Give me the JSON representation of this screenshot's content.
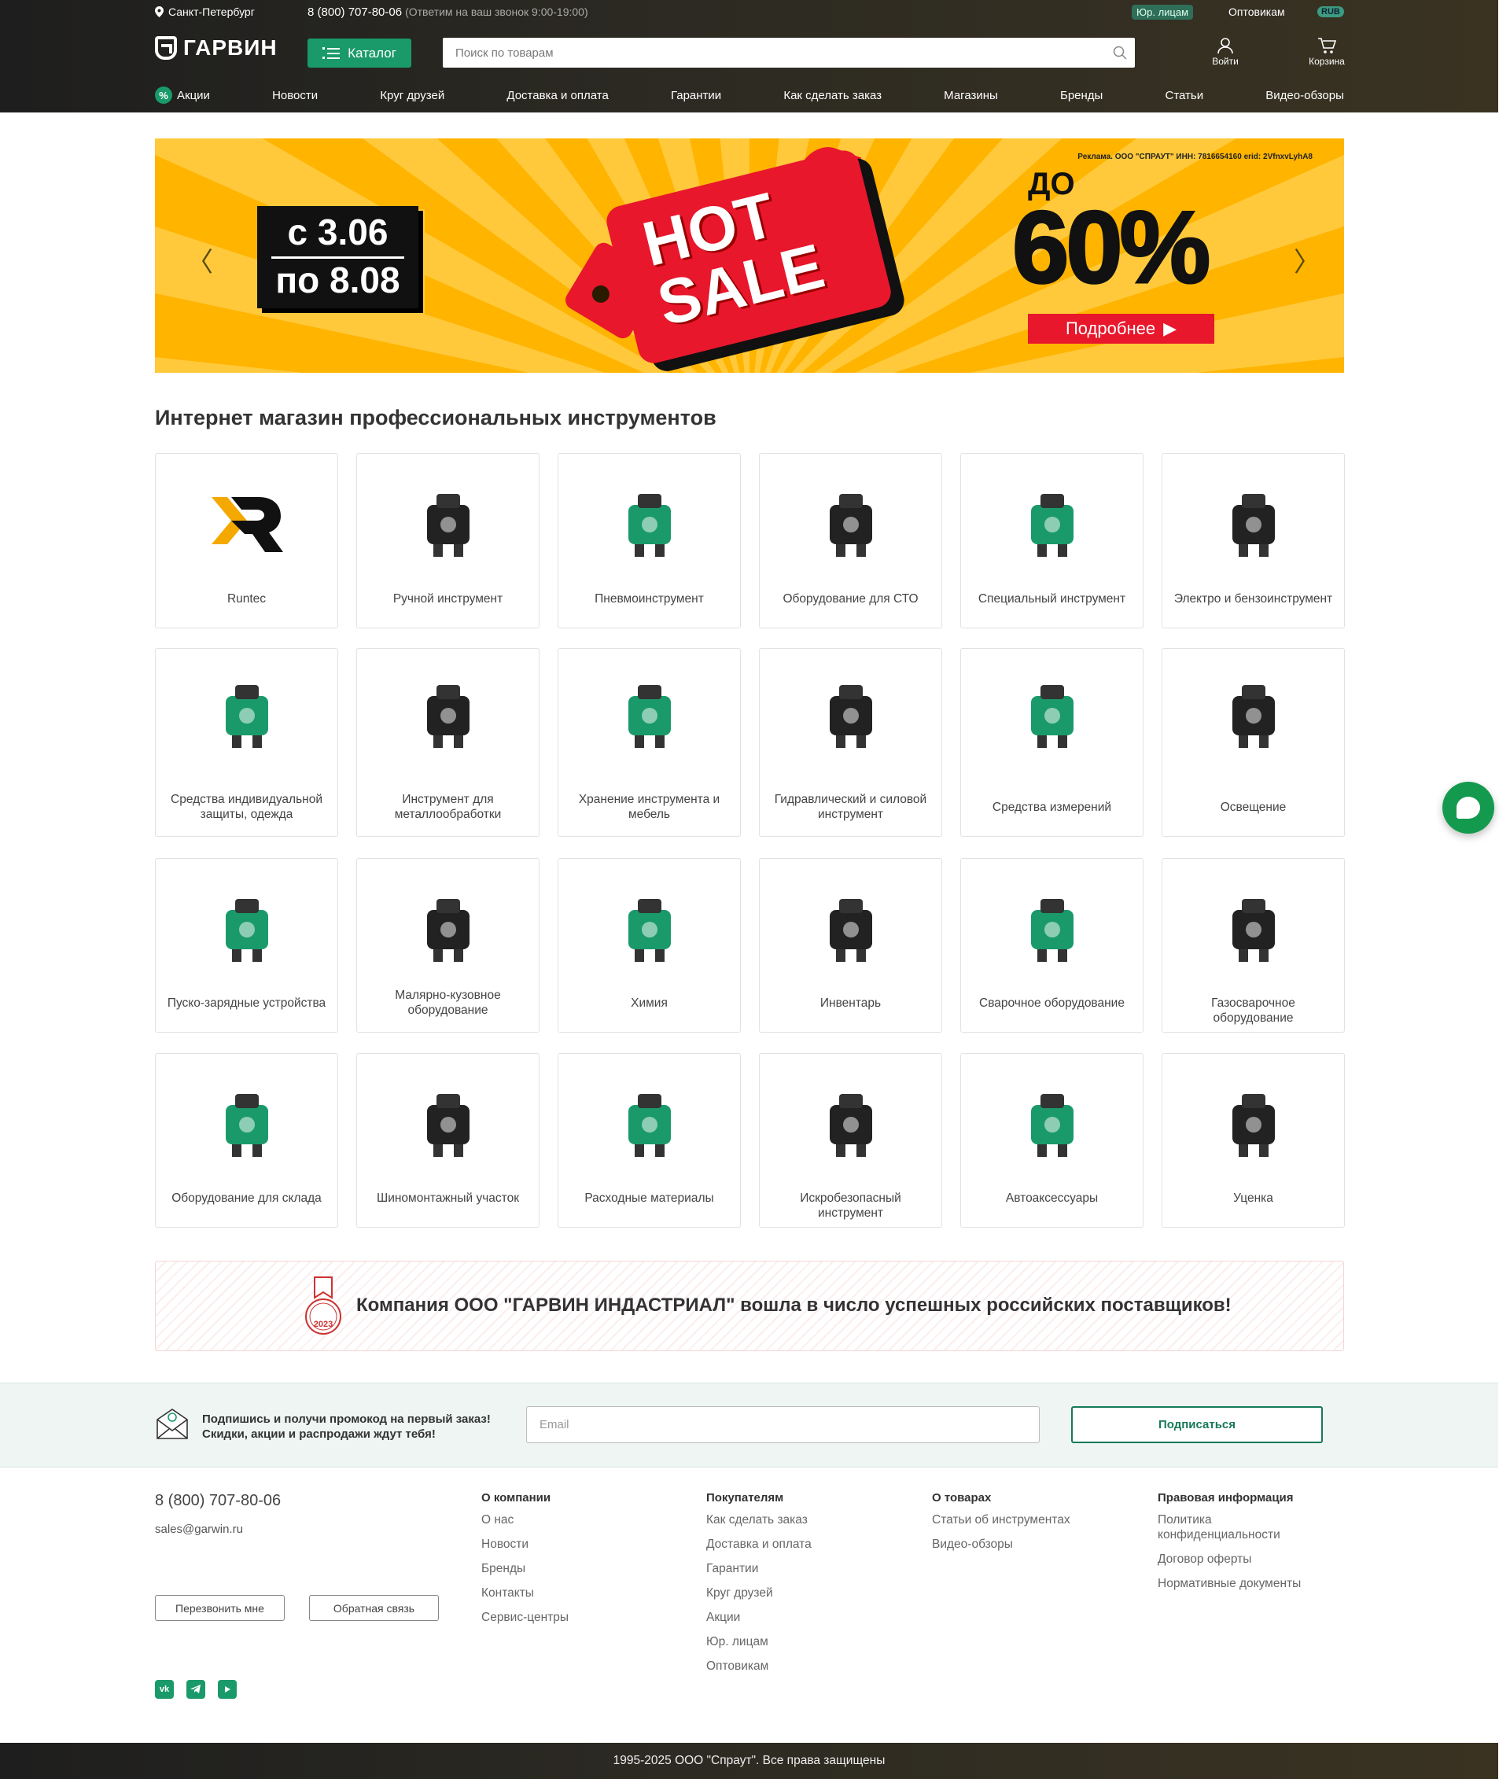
{
  "topbar": {
    "city": "Санкт-Петербург",
    "phone": "8 (800) 707-80-06",
    "phone_note": "(Ответим на ваш звонок 9:00-19:00)",
    "legal": "Юр. лицам",
    "wholesale": "Оптовикам",
    "currency": "RUB"
  },
  "header": {
    "logo": "ГАРВИН",
    "catalog": "Каталог",
    "search_placeholder": "Поиск по товарам",
    "login": "Войти",
    "cart": "Корзина"
  },
  "nav": [
    "Акции",
    "Новости",
    "Круг друзей",
    "Доставка и оплата",
    "Гарантии",
    "Как сделать заказ",
    "Магазины",
    "Бренды",
    "Статьи",
    "Видео-обзоры"
  ],
  "banner": {
    "ad": "Реклама. ООО \"СПРАУТ\" ИНН: 7816654160 erid: 2VfnxvLyhA8",
    "date_from": "с 3.06",
    "date_to": "по 8.08",
    "hot": "HOT",
    "sale": "SALE",
    "upto": "ДО",
    "percent": "60%",
    "more": "Подробнее"
  },
  "page_title": "Интернет магазин профессиональных инструментов",
  "categories": [
    {
      "label": "Runtec",
      "icon": "runtec-logo-icon"
    },
    {
      "label": "Ручной инструмент",
      "icon": "hand-tool-icon"
    },
    {
      "label": "Пневмоинструмент",
      "icon": "pneumatic-tool-icon"
    },
    {
      "label": "Оборудование для СТО",
      "icon": "jack-icon"
    },
    {
      "label": "Специальный инструмент",
      "icon": "special-tool-icon"
    },
    {
      "label": "Электро и бензоинструмент",
      "icon": "power-tool-icon"
    },
    {
      "label": "Средства индивидуальной защиты, одежда",
      "icon": "protective-suit-icon"
    },
    {
      "label": "Инструмент для металлообработки",
      "icon": "metalwork-tool-icon"
    },
    {
      "label": "Хранение инструмента и мебель",
      "icon": "tool-cabinet-icon"
    },
    {
      "label": "Гидравлический и силовой инструмент",
      "icon": "hydraulic-tool-icon"
    },
    {
      "label": "Средства измерений",
      "icon": "tape-measure-icon"
    },
    {
      "label": "Освещение",
      "icon": "floodlight-icon"
    },
    {
      "label": "Пуско-зарядные устройства",
      "icon": "jump-starter-icon"
    },
    {
      "label": "Малярно-кузовное оборудование",
      "icon": "spray-gun-icon"
    },
    {
      "label": "Химия",
      "icon": "chemistry-icon"
    },
    {
      "label": "Инвентарь",
      "icon": "wheelbarrow-icon"
    },
    {
      "label": "Сварочное оборудование",
      "icon": "welder-icon"
    },
    {
      "label": "Газосварочное оборудование",
      "icon": "gas-welding-icon"
    },
    {
      "label": "Оборудование для склада",
      "icon": "pallet-jack-icon"
    },
    {
      "label": "Шиномонтажный участок",
      "icon": "tire-changer-icon"
    },
    {
      "label": "Расходные материалы",
      "icon": "cutting-disc-icon"
    },
    {
      "label": "Искробезопасный инструмент",
      "icon": "spark-free-wrench-icon"
    },
    {
      "label": "Автоаксессуары",
      "icon": "compressor-icon"
    },
    {
      "label": "Уценка",
      "icon": "discount-basket-icon"
    }
  ],
  "supplier": {
    "text": "Компания ООО \"ГАРВИН ИНДАСТРИАЛ\" вошла в число успешных российских поставщиков!",
    "badge_year": "2023"
  },
  "subscribe": {
    "line1": "Подпишись и получи промокод на первый заказ!",
    "line2": "Скидки, акции и распродажи ждут тебя!",
    "email_placeholder": "Email",
    "button": "Подписаться"
  },
  "footer": {
    "phone": "8 (800) 707-80-06",
    "email": "sales@garwin.ru",
    "callback": "Перезвонить мне",
    "feedback": "Обратная связь",
    "columns": [
      {
        "title": "О компании",
        "items": [
          "О нас",
          "Новости",
          "Бренды",
          "Контакты",
          "Сервис-центры"
        ]
      },
      {
        "title": "Покупателям",
        "items": [
          "Как сделать заказ",
          "Доставка и оплата",
          "Гарантии",
          "Круг друзей",
          "Акции",
          "Юр. лицам",
          "Оптовикам"
        ]
      },
      {
        "title": "О товарах",
        "items": [
          "Статьи об инструментах",
          "Видео-обзоры"
        ]
      },
      {
        "title": "Правовая информация",
        "items": [
          "Политика конфиденциальности",
          "Договор оферты",
          "Нормативные документы"
        ]
      }
    ]
  },
  "copyright": "1995-2025 ООО \"Спраут\". Все права защищены",
  "colors": {
    "accent": "#1a9a6b",
    "banner_red": "#e8172c",
    "banner_yellow": "#ffc93b"
  }
}
